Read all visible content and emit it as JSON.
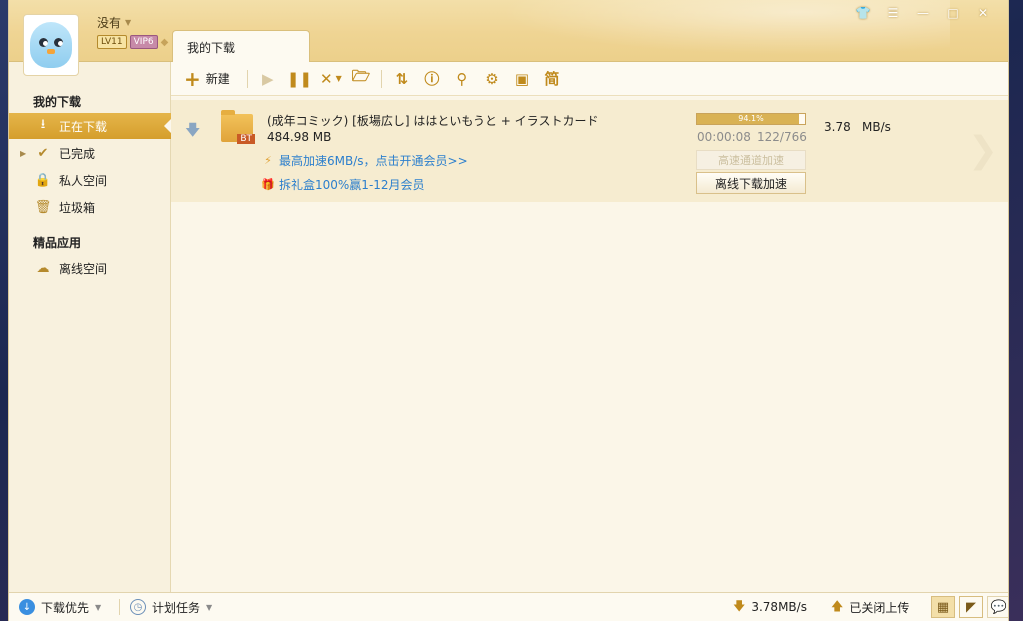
{
  "user": {
    "name": "没有",
    "level": "LV11",
    "vip": "VIP6"
  },
  "tabs": {
    "active": "我的下载"
  },
  "toolbar": {
    "new_label": "新建",
    "simplified_label": "简"
  },
  "sidebar": {
    "section_downloads": "我的下载",
    "items": [
      {
        "label": "正在下载"
      },
      {
        "label": "已完成"
      },
      {
        "label": "私人空间"
      },
      {
        "label": "垃圾箱"
      }
    ],
    "section_apps": "精品应用",
    "apps": [
      {
        "label": "离线空间"
      }
    ]
  },
  "task": {
    "name": "(成年コミック) [板場広し] ははといもうと + イラストカード",
    "size": "484.98 MB",
    "type_tag": "BT",
    "progress_text": "94.1%",
    "progress_fraction": 0.941,
    "elapsed": "00:00:08",
    "pieces": "122/766",
    "speed": "3.78",
    "speed_unit": "MB/s",
    "promo1": "最高加速6MB/s，点击开通会员>>",
    "promo2": "拆礼盒100%赢1-12月会员",
    "boost_button": "高速通道加速",
    "offline_button": "离线下载加速"
  },
  "statusbar": {
    "priority_label": "下载优先",
    "schedule_label": "计划任务",
    "down_speed": "3.78MB/s",
    "upload_label": "已关闭上传"
  },
  "colors": {
    "accent": "#d59e2c",
    "link": "#2c7fcd",
    "topbar": "#efd493"
  }
}
